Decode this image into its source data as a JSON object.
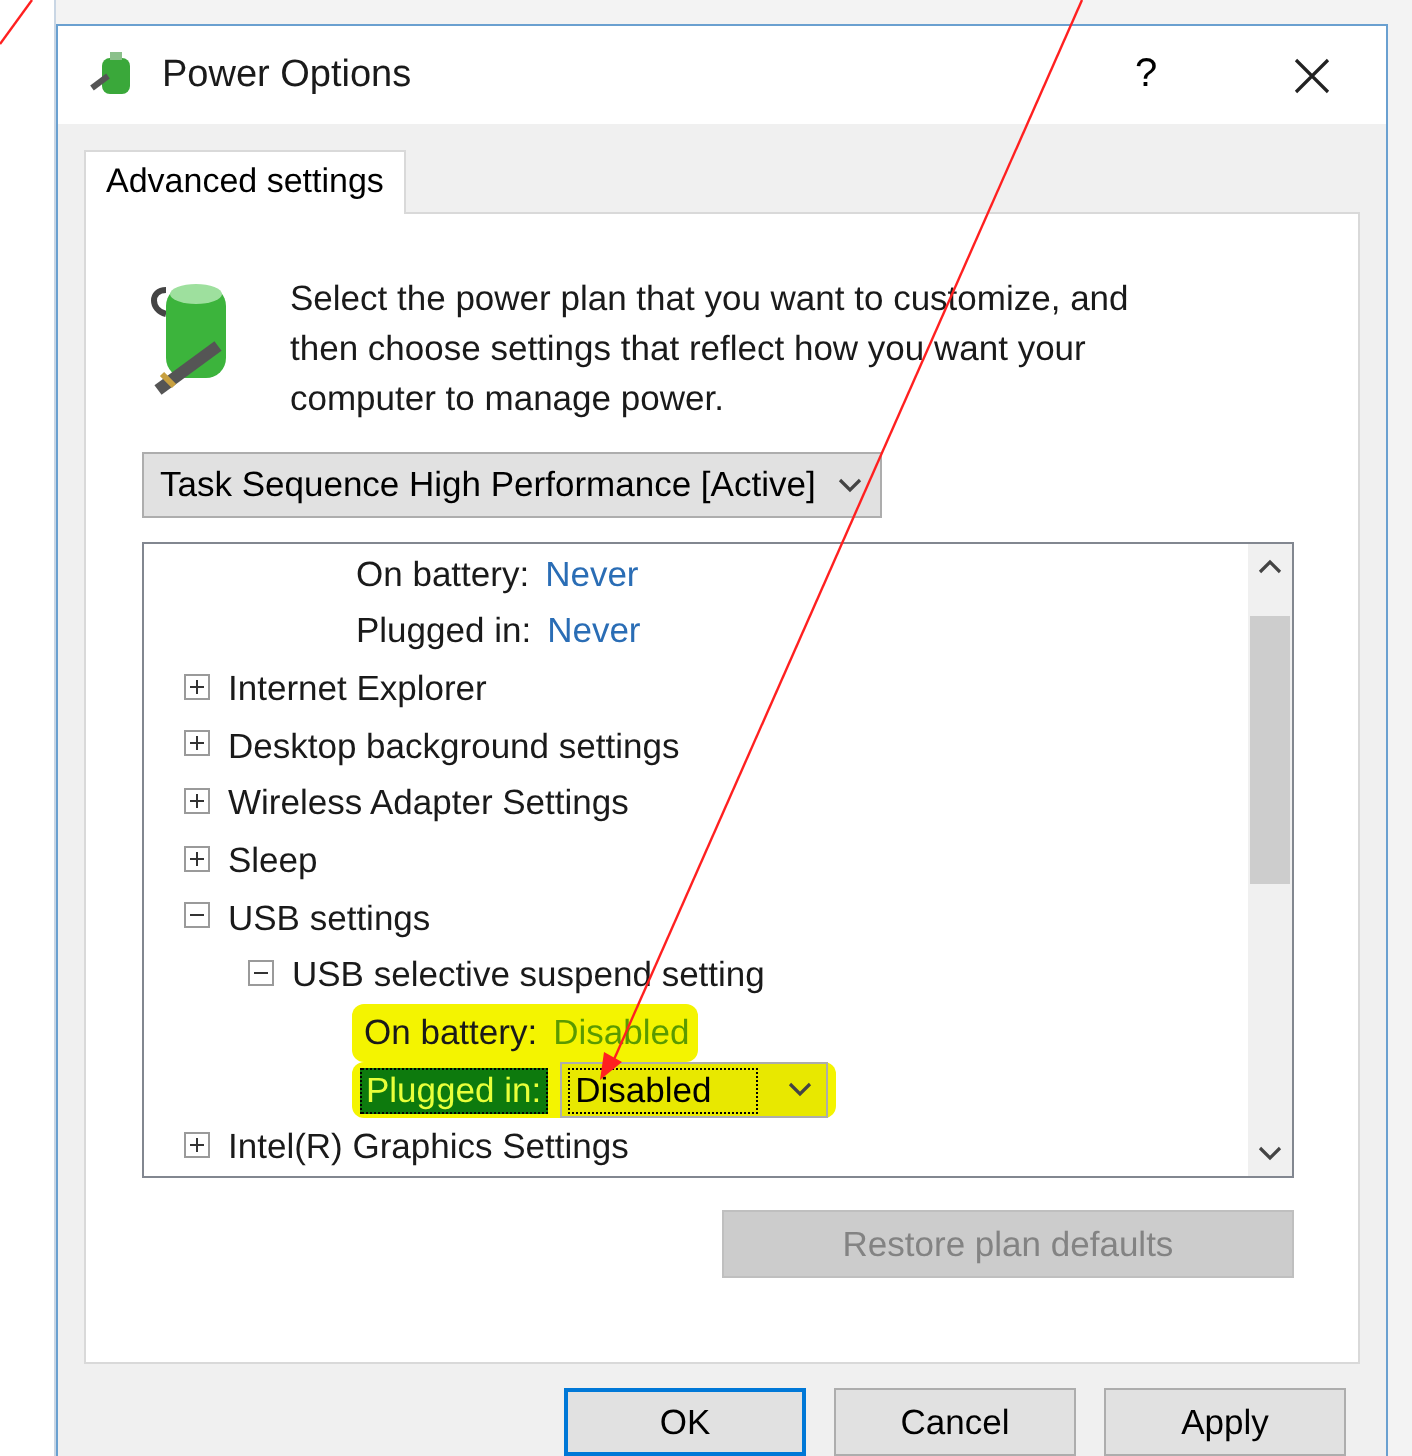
{
  "window": {
    "title": "Power Options",
    "help": "?"
  },
  "tabs": [
    {
      "label": "Advanced settings",
      "selected": true
    }
  ],
  "intro": "Select the power plan that you want to customize, and then choose settings that reflect how you want your computer to manage power.",
  "plan_dropdown": {
    "value": "Task Sequence High Performance [Active]"
  },
  "tree": [
    {
      "kind": "value",
      "label": "On battery:",
      "value": "Never",
      "highlighted": false,
      "selected": false
    },
    {
      "kind": "value",
      "label": "Plugged in:",
      "value": "Never",
      "highlighted": false,
      "selected": false
    },
    {
      "kind": "node",
      "label": "Internet Explorer",
      "expanded": false
    },
    {
      "kind": "node",
      "label": "Desktop background settings",
      "expanded": false
    },
    {
      "kind": "node",
      "label": "Wireless Adapter Settings",
      "expanded": false
    },
    {
      "kind": "node",
      "label": "Sleep",
      "expanded": false
    },
    {
      "kind": "node",
      "label": "USB settings",
      "expanded": true,
      "children": [
        {
          "kind": "node",
          "label": "USB selective suspend setting",
          "expanded": true,
          "children": [
            {
              "kind": "value",
              "label": "On battery:",
              "value": "Disabled",
              "highlighted": true,
              "selected": false
            },
            {
              "kind": "dropdown",
              "label": "Plugged in:",
              "value": "Disabled",
              "highlighted": true,
              "selected": true
            }
          ]
        }
      ]
    },
    {
      "kind": "node",
      "label": "Intel(R) Graphics Settings",
      "expanded": false
    }
  ],
  "restore_button": {
    "label": "Restore plan defaults",
    "disabled": true
  },
  "buttons": [
    {
      "label": "OK",
      "default": true
    },
    {
      "label": "Cancel",
      "default": false
    },
    {
      "label": "Apply",
      "default": false
    }
  ]
}
